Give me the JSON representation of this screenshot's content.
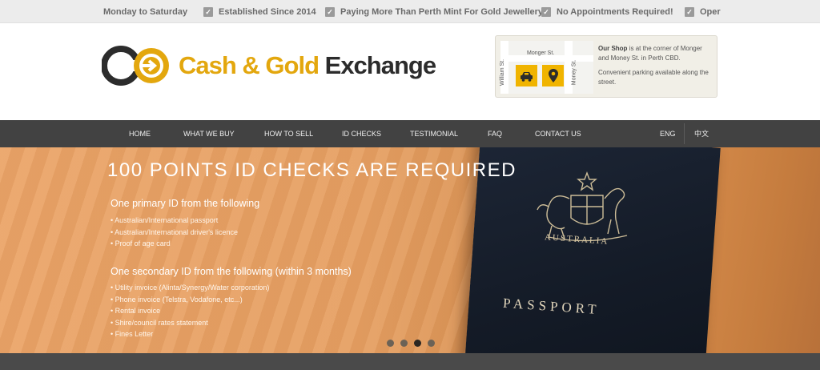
{
  "topbar": {
    "items": [
      {
        "label": "Monday to Saturday",
        "checked": false
      },
      {
        "label": "Established Since 2014",
        "checked": true
      },
      {
        "label": "Paying More Than Perth Mint For Gold Jewellery",
        "checked": true
      },
      {
        "label": "No Appointments Required!",
        "checked": true
      },
      {
        "label": "Oper",
        "checked": true
      }
    ]
  },
  "brand": {
    "name_part1": "Cash & Gold",
    "name_part2": "Exchange",
    "logo_icon": "gold-coin-arrow-logo"
  },
  "map": {
    "street_top": "Monger St.",
    "street_left": "William St.",
    "street_right": "Money St.",
    "shop_label": "Our Shop",
    "shop_text": "is at the corner of Monger and Money St. in Perth CBD.",
    "parking_text": "Convenient parking available along the street.",
    "icons": [
      "car-icon",
      "location-pin-icon"
    ]
  },
  "nav": {
    "items": [
      "HOME",
      "WHAT WE BUY",
      "HOW TO SELL",
      "ID CHECKS",
      "TESTIMONIAL",
      "FAQ",
      "CONTACT US"
    ],
    "lang_en": "ENG",
    "lang_zh": "中文"
  },
  "hero": {
    "title": "100 POINTS ID CHECKS ARE REQUIRED",
    "primary_heading": "One primary ID from the following",
    "primary_items": [
      "Australian/International passport",
      "Australian/International driver's licence",
      "Proof of age card"
    ],
    "secondary_heading": "One secondary ID from the following (within 3 months)",
    "secondary_items": [
      "Utility invoice (Alinta/Synergy/Water corporation)",
      "Phone invoice (Telstra, Vodafone, etc...)",
      "Rental invoice",
      "Shire/council rates statement",
      "Fines Letter"
    ],
    "passport_country": "AUSTRALIA",
    "passport_word": "PASSPORT",
    "slides_total": 4,
    "slide_active": 3
  },
  "colors": {
    "gold": "#e3a70e",
    "nav_bg": "#424242",
    "hero_orange": "#eba569"
  }
}
